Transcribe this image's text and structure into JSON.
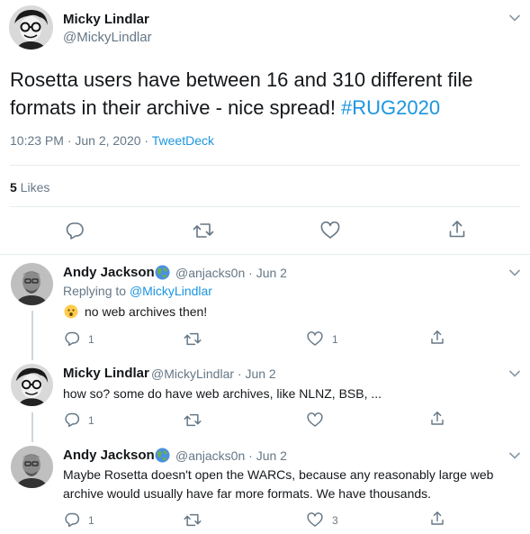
{
  "main_tweet": {
    "name": "Micky Lindlar",
    "handle": "@MickyLindlar",
    "text_plain": "Rosetta users have between 16 and 310 different file formats in their archive - nice spread! ",
    "hashtag": "#RUG2020",
    "time": "10:23 PM · Jun 2, 2020 · ",
    "via": "TweetDeck",
    "likes_count": "5",
    "likes_label": " Likes"
  },
  "replies": [
    {
      "name": "Andy Jackson",
      "handle": "@anjacks0n · Jun 2",
      "replying_prefix": "Replying to ",
      "replying_to": "@MickyLindlar",
      "text": "no web archives then!",
      "reply_count": "1",
      "like_count": "1"
    },
    {
      "name": "Micky Lindlar",
      "handle": "@MickyLindlar · Jun 2",
      "text": "how so? some do have web archives, like NLNZ, BSB, ...",
      "reply_count": "1"
    },
    {
      "name": "Andy Jackson",
      "handle": "@anjacks0n · Jun 2",
      "text_line1": "Maybe Rosetta doesn't open the WARCs, because any reasonably large web",
      "text_line2": "archive would usually have far more formats. We have thousands.",
      "reply_count": "1",
      "like_count": "3"
    }
  ],
  "colors": {
    "accent": "#1b95e0",
    "secondary_text": "#657786",
    "icon": "#657786",
    "divider": "#e6ecf0",
    "thread_line": "#ccd6dd"
  },
  "icons": [
    "chevron-down-icon",
    "reply-icon",
    "retweet-icon",
    "like-icon",
    "share-icon",
    "globe-icon",
    "surprised-emoji-icon"
  ]
}
